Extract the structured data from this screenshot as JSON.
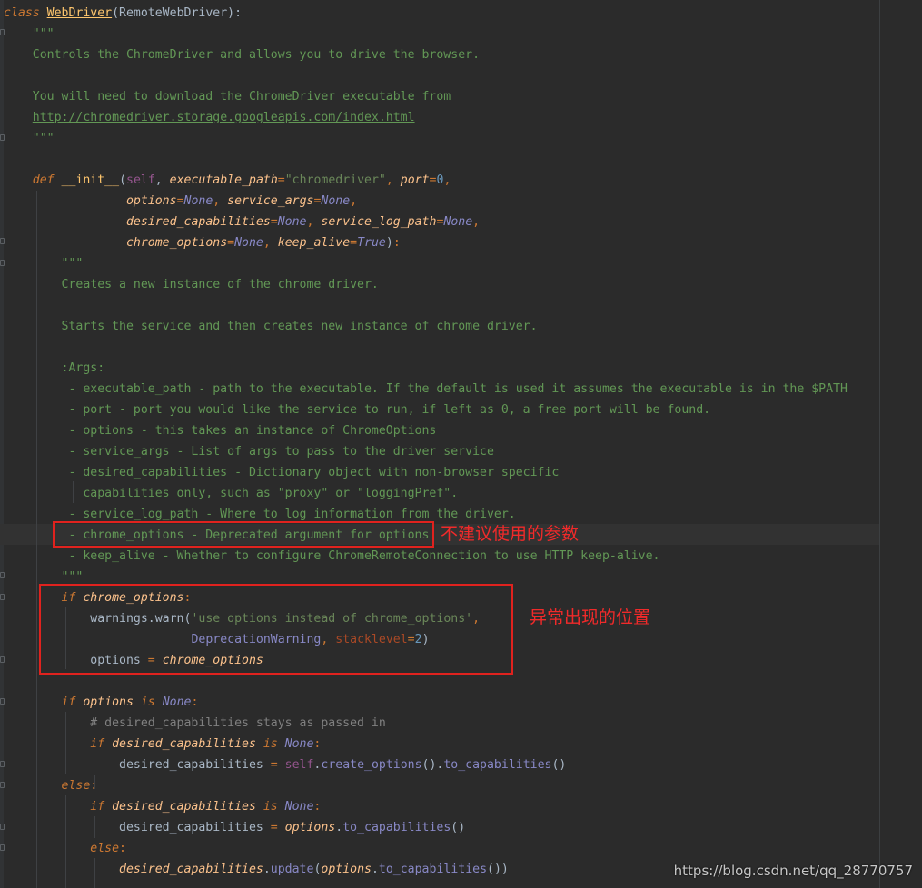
{
  "editor": {
    "lines": [
      {
        "segments": [
          {
            "c": "kw",
            "t": "class "
          },
          {
            "c": "cls",
            "t": "WebDriver"
          },
          {
            "c": "call",
            "t": "(RemoteWebDriver):"
          }
        ]
      },
      {
        "segments": [
          {
            "c": "doc",
            "t": "    \"\"\""
          }
        ]
      },
      {
        "segments": [
          {
            "c": "doc",
            "t": "    Controls the ChromeDriver and allows you to drive the browser."
          }
        ]
      },
      {
        "segments": [
          {
            "c": "doc",
            "t": ""
          }
        ]
      },
      {
        "segments": [
          {
            "c": "doc",
            "t": "    You will need to download the ChromeDriver executable from"
          }
        ]
      },
      {
        "segments": [
          {
            "c": "doc",
            "t": "    "
          },
          {
            "c": "link",
            "t": "http://chromedriver.storage.googleapis.com/index.html"
          }
        ]
      },
      {
        "segments": [
          {
            "c": "doc",
            "t": "    \"\"\""
          }
        ]
      },
      {
        "segments": [
          {
            "c": "doc",
            "t": ""
          }
        ]
      },
      {
        "segments": [
          {
            "c": "kw",
            "t": "    def "
          },
          {
            "c": "fn",
            "t": "__init__"
          },
          {
            "c": "call",
            "t": "("
          },
          {
            "c": "self",
            "t": "self"
          },
          {
            "c": "call",
            "t": ", "
          },
          {
            "c": "param2",
            "t": "executable_path"
          },
          {
            "c": "kwp",
            "t": "="
          },
          {
            "c": "str",
            "t": "\"chromedriver\""
          },
          {
            "c": "kwp",
            "t": ", "
          },
          {
            "c": "param2",
            "t": "port"
          },
          {
            "c": "kwp",
            "t": "="
          },
          {
            "c": "num",
            "t": "0"
          },
          {
            "c": "kwp",
            "t": ","
          }
        ]
      },
      {
        "segments": [
          {
            "c": "call",
            "t": "                 "
          },
          {
            "c": "param2",
            "t": "options"
          },
          {
            "c": "kwp",
            "t": "="
          },
          {
            "c": "const",
            "t": "None"
          },
          {
            "c": "kwp",
            "t": ", "
          },
          {
            "c": "param2",
            "t": "service_args"
          },
          {
            "c": "kwp",
            "t": "="
          },
          {
            "c": "const",
            "t": "None"
          },
          {
            "c": "kwp",
            "t": ","
          }
        ]
      },
      {
        "segments": [
          {
            "c": "call",
            "t": "                 "
          },
          {
            "c": "param2",
            "t": "desired_capabilities"
          },
          {
            "c": "kwp",
            "t": "="
          },
          {
            "c": "const",
            "t": "None"
          },
          {
            "c": "kwp",
            "t": ", "
          },
          {
            "c": "param2",
            "t": "service_log_path"
          },
          {
            "c": "kwp",
            "t": "="
          },
          {
            "c": "const",
            "t": "None"
          },
          {
            "c": "kwp",
            "t": ","
          }
        ]
      },
      {
        "segments": [
          {
            "c": "call",
            "t": "                 "
          },
          {
            "c": "param2",
            "t": "chrome_options"
          },
          {
            "c": "kwp",
            "t": "="
          },
          {
            "c": "const",
            "t": "None"
          },
          {
            "c": "kwp",
            "t": ", "
          },
          {
            "c": "param2",
            "t": "keep_alive"
          },
          {
            "c": "kwp",
            "t": "="
          },
          {
            "c": "const",
            "t": "True"
          },
          {
            "c": "call",
            "t": ")"
          },
          {
            "c": "kwp",
            "t": ":"
          }
        ]
      },
      {
        "segments": [
          {
            "c": "doc",
            "t": "        \"\"\""
          }
        ]
      },
      {
        "segments": [
          {
            "c": "doc",
            "t": "        Creates a new instance of the chrome driver."
          }
        ]
      },
      {
        "segments": [
          {
            "c": "doc",
            "t": ""
          }
        ]
      },
      {
        "segments": [
          {
            "c": "doc",
            "t": "        Starts the service and then creates new instance of chrome driver."
          }
        ]
      },
      {
        "segments": [
          {
            "c": "doc",
            "t": ""
          }
        ]
      },
      {
        "segments": [
          {
            "c": "doc",
            "t": "        :Args:"
          }
        ]
      },
      {
        "segments": [
          {
            "c": "doc",
            "t": "         - executable_path - path to the executable. If the default is used it assumes the executable is in the $PATH"
          }
        ]
      },
      {
        "segments": [
          {
            "c": "doc",
            "t": "         - port - port you would like the service to run, if left as 0, a free port will be found."
          }
        ]
      },
      {
        "segments": [
          {
            "c": "doc",
            "t": "         - options - this takes an instance of ChromeOptions"
          }
        ]
      },
      {
        "segments": [
          {
            "c": "doc",
            "t": "         - service_args - List of args to pass to the driver service"
          }
        ]
      },
      {
        "segments": [
          {
            "c": "doc",
            "t": "         - desired_capabilities - Dictionary object with non-browser specific"
          }
        ]
      },
      {
        "segments": [
          {
            "c": "doc",
            "t": "           capabilities only, such as \"proxy\" or \"loggingPref\"."
          }
        ]
      },
      {
        "segments": [
          {
            "c": "doc",
            "t": "         - service_log_path - Where to log information from the driver."
          }
        ]
      },
      {
        "segments": [
          {
            "c": "doc",
            "t": "         - chrome_options - Deprecated argument for options"
          }
        ]
      },
      {
        "segments": [
          {
            "c": "doc",
            "t": "         - keep_alive - Whether to configure ChromeRemoteConnection to use HTTP keep-alive."
          }
        ]
      },
      {
        "segments": [
          {
            "c": "doc",
            "t": "        \"\"\""
          }
        ]
      },
      {
        "segments": [
          {
            "c": "kw",
            "t": "        if "
          },
          {
            "c": "param2",
            "t": "chrome_options"
          },
          {
            "c": "kwp",
            "t": ":"
          }
        ]
      },
      {
        "segments": [
          {
            "c": "call",
            "t": "            warnings.warn("
          },
          {
            "c": "str",
            "t": "'use options instead of chrome_options'"
          },
          {
            "c": "kwp",
            "t": ","
          }
        ]
      },
      {
        "segments": [
          {
            "c": "call",
            "t": "                          "
          },
          {
            "c": "builtin",
            "t": "DeprecationWarning"
          },
          {
            "c": "kwp",
            "t": ", "
          },
          {
            "c": "named",
            "t": "stacklevel"
          },
          {
            "c": "kwp",
            "t": "="
          },
          {
            "c": "num",
            "t": "2"
          },
          {
            "c": "call",
            "t": ")"
          }
        ]
      },
      {
        "segments": [
          {
            "c": "call",
            "t": "            options "
          },
          {
            "c": "kwp",
            "t": "= "
          },
          {
            "c": "param2",
            "t": "chrome_options"
          }
        ]
      },
      {
        "segments": [
          {
            "c": "doc",
            "t": ""
          }
        ]
      },
      {
        "segments": [
          {
            "c": "kw",
            "t": "        if "
          },
          {
            "c": "param2",
            "t": "options"
          },
          {
            "c": "kw",
            "t": " is "
          },
          {
            "c": "const",
            "t": "None"
          },
          {
            "c": "kwp",
            "t": ":"
          }
        ]
      },
      {
        "segments": [
          {
            "c": "cmt",
            "t": "            # desired_capabilities stays as passed in"
          }
        ]
      },
      {
        "segments": [
          {
            "c": "kw",
            "t": "            if "
          },
          {
            "c": "param2",
            "t": "desired_capabilities"
          },
          {
            "c": "kw",
            "t": " is "
          },
          {
            "c": "const",
            "t": "None"
          },
          {
            "c": "kwp",
            "t": ":"
          }
        ]
      },
      {
        "segments": [
          {
            "c": "call",
            "t": "                desired_capabilities "
          },
          {
            "c": "kwp",
            "t": "= "
          },
          {
            "c": "self",
            "t": "self"
          },
          {
            "c": "call",
            "t": "."
          },
          {
            "c": "builtin",
            "t": "create_options"
          },
          {
            "c": "call",
            "t": "()."
          },
          {
            "c": "builtin",
            "t": "to_capabilities"
          },
          {
            "c": "call",
            "t": "()"
          }
        ]
      },
      {
        "segments": [
          {
            "c": "kw",
            "t": "        else"
          },
          {
            "c": "kwp",
            "t": ":"
          }
        ]
      },
      {
        "segments": [
          {
            "c": "kw",
            "t": "            if "
          },
          {
            "c": "param2",
            "t": "desired_capabilities"
          },
          {
            "c": "kw",
            "t": " is "
          },
          {
            "c": "const",
            "t": "None"
          },
          {
            "c": "kwp",
            "t": ":"
          }
        ]
      },
      {
        "segments": [
          {
            "c": "call",
            "t": "                desired_capabilities "
          },
          {
            "c": "kwp",
            "t": "= "
          },
          {
            "c": "param2",
            "t": "options"
          },
          {
            "c": "call",
            "t": "."
          },
          {
            "c": "builtin",
            "t": "to_capabilities"
          },
          {
            "c": "call",
            "t": "()"
          }
        ]
      },
      {
        "segments": [
          {
            "c": "kw",
            "t": "            else"
          },
          {
            "c": "kwp",
            "t": ":"
          }
        ]
      },
      {
        "segments": [
          {
            "c": "call",
            "t": "                "
          },
          {
            "c": "param2",
            "t": "desired_capabilities"
          },
          {
            "c": "call",
            "t": "."
          },
          {
            "c": "builtin",
            "t": "update"
          },
          {
            "c": "call",
            "t": "("
          },
          {
            "c": "param2",
            "t": "options"
          },
          {
            "c": "call",
            "t": "."
          },
          {
            "c": "builtin",
            "t": "to_capabilities"
          },
          {
            "c": "call",
            "t": "())"
          }
        ]
      }
    ]
  },
  "annotations": {
    "deprecated_note": "不建议使用的参数",
    "exception_note": "异常出现的位置"
  },
  "watermark": "https://blog.csdn.net/qq_28770757",
  "colors": {
    "background": "#2b2b2b",
    "annotation_red": "#e0221e"
  }
}
